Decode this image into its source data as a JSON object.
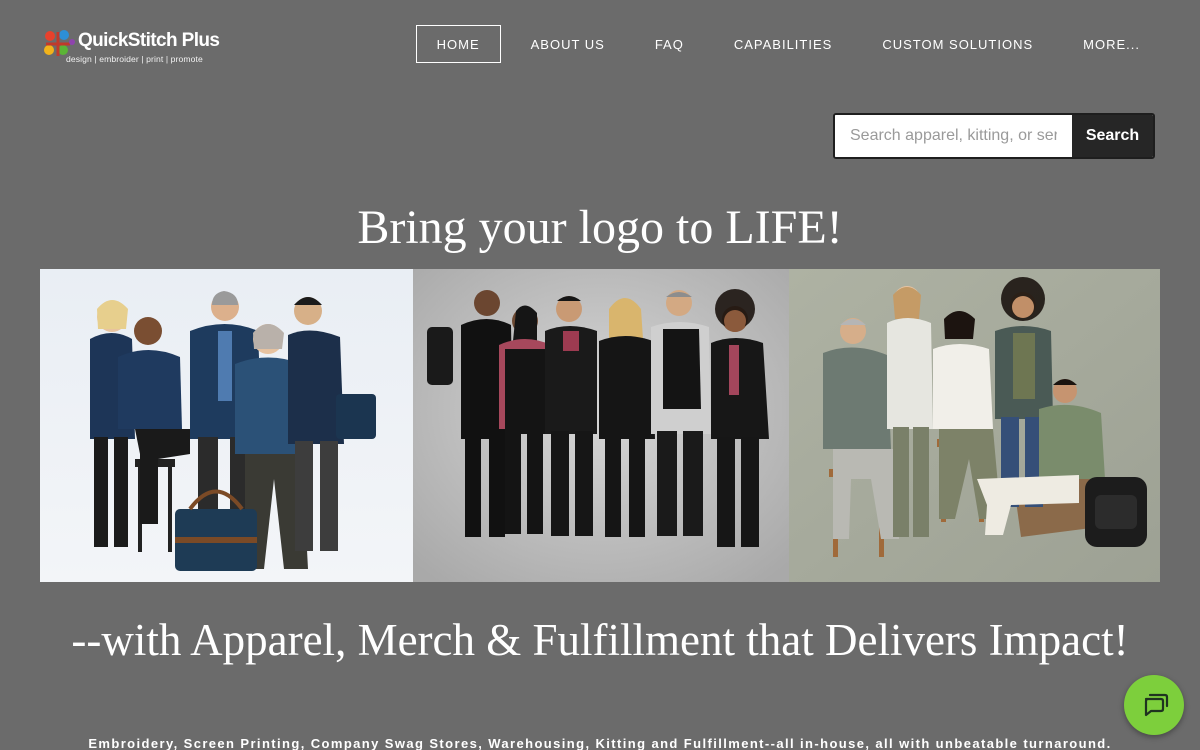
{
  "brand": {
    "name": "QuickStitch Plus",
    "tagline": "design | embroider | print | promote"
  },
  "nav": {
    "items": [
      {
        "label": "HOME",
        "active": true
      },
      {
        "label": "ABOUT US",
        "active": false
      },
      {
        "label": "FAQ",
        "active": false
      },
      {
        "label": "CAPABILITIES",
        "active": false
      },
      {
        "label": "CUSTOM SOLUTIONS",
        "active": false
      },
      {
        "label": "MORE...",
        "active": false
      }
    ]
  },
  "search": {
    "placeholder": "Search apparel, kitting, or services",
    "value": "",
    "button_label": "Search"
  },
  "hero": {
    "title": "Bring your logo to LIFE!",
    "subtitle": "--with Apparel, Merch & Fulfillment that Delivers Impact!",
    "services": "Embroidery, Screen Printing, Company Swag Stores, Warehousing, Kitting and Fulfillment--all in-house, all with unbeatable turnaround."
  },
  "photos": [
    {
      "icon": "group-photo-navy-apparel"
    },
    {
      "icon": "group-photo-black-apparel"
    },
    {
      "icon": "group-photo-casual-apparel"
    }
  ],
  "colors": {
    "page_background": "#6b6b6b",
    "chat_button": "#7dcf3c",
    "search_button": "#262626"
  },
  "chat": {
    "icon": "chat-bubble-icon"
  }
}
